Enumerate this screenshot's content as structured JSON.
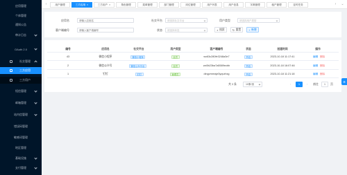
{
  "sidebar": {
    "items": [
      {
        "label": "应用管理"
      },
      {
        "label": "个体管理"
      },
      {
        "label": "通知公告"
      },
      {
        "label": "审计日志"
      },
      {
        "label": "OAuth 2.0"
      },
      {
        "label": "社交管理"
      },
      {
        "label": "三方应用"
      },
      {
        "label": "三方用户"
      },
      {
        "label": "短信管理"
      },
      {
        "label": "邮箱管理"
      },
      {
        "label": "站内信管理"
      },
      {
        "label": "错误码管理"
      },
      {
        "label": "敏感词管理"
      },
      {
        "label": "地区管理"
      },
      {
        "label": "基础设施"
      },
      {
        "label": "支付管理"
      }
    ]
  },
  "tabs": [
    {
      "label": "用户管理"
    },
    {
      "label": "三方应用"
    },
    {
      "label": "三方用户"
    },
    {
      "label": "角色管理"
    },
    {
      "label": "菜单管理"
    },
    {
      "label": "部门管理"
    },
    {
      "label": "岗位管理"
    },
    {
      "label": "用户列表"
    },
    {
      "label": "用户信息"
    },
    {
      "label": "字典管理"
    },
    {
      "label": "租户管理"
    },
    {
      "label": "定时任务"
    }
  ],
  "search": {
    "app_name_label": "应用名",
    "app_name_placeholder": "请输入应用名",
    "social_platform_label": "社交平台",
    "social_platform_placeholder": "请选择社交平台",
    "user_type_label": "用户类型",
    "user_type_placeholder": "请选择用户类型",
    "client_id_label": "客户端编号",
    "client_id_placeholder": "请输入客户端编号",
    "status_label": "状态",
    "status_placeholder": "请选择状态",
    "search_btn": "搜索",
    "reset_btn": "重置",
    "add_btn": "新增"
  },
  "table": {
    "headers": [
      "编号",
      "应用名",
      "社交平台",
      "用户类型",
      "客户端编号",
      "状态",
      "创建时间",
      "操作"
    ],
    "rows": [
      {
        "id": "43",
        "name": "微信小程序",
        "platform": "微信小程序",
        "user_type": "会员",
        "client_id": "wx63c280fe3248a3e7",
        "status": "开启",
        "created": "2023-10-18 11:17:41",
        "edit": "编辑",
        "delete": "删除"
      },
      {
        "id": "2",
        "name": "微信公众号",
        "platform": "微信公众平台",
        "user_type": "会员",
        "client_id": "wx5b23ba7a5589ecbb",
        "status": "开启",
        "created": "2023-10-18 16:07:46",
        "edit": "编辑",
        "delete": "删除"
      },
      {
        "id": "1",
        "name": "钉钉",
        "platform": "钉钉",
        "user_type": "管理员",
        "client_id": "dingvrnreaje3yqvzhxg",
        "status": "开启",
        "created": "2023-10-18 11:21:18",
        "edit": "编辑",
        "delete": "删除"
      }
    ]
  },
  "pagination": {
    "total": "共 3 条",
    "page_size": "10条/页",
    "current": "1",
    "goto_label": "前往",
    "goto_value": "1",
    "page_suffix": "页"
  },
  "colors": {
    "primary": "#1890ff",
    "sidebar": "#001529"
  }
}
